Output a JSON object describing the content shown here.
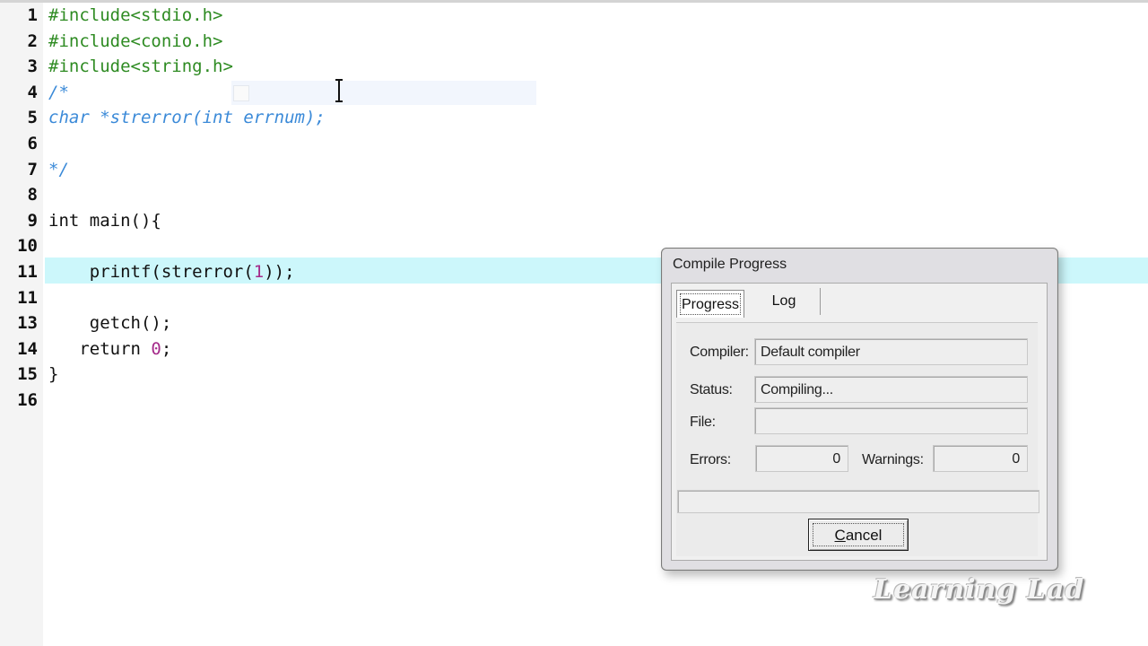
{
  "editor": {
    "active_line": 11,
    "lines": [
      {
        "n": "1",
        "segments": [
          {
            "t": "#include<stdio.h>",
            "c": "pp"
          }
        ]
      },
      {
        "n": "2",
        "segments": [
          {
            "t": "#include<conio.h>",
            "c": "pp"
          }
        ]
      },
      {
        "n": "3",
        "segments": [
          {
            "t": "#include<string.h>",
            "c": "pp"
          }
        ]
      },
      {
        "n": "4",
        "segments": [
          {
            "t": "/*",
            "c": "cm"
          }
        ]
      },
      {
        "n": "5",
        "segments": [
          {
            "t": "char *strerror(int errnum);",
            "c": "cm"
          }
        ]
      },
      {
        "n": "6",
        "segments": []
      },
      {
        "n": "7",
        "segments": [
          {
            "t": "*/",
            "c": "cm"
          }
        ]
      },
      {
        "n": "8",
        "segments": []
      },
      {
        "n": "9",
        "segments": [
          {
            "t": "int main(){",
            "c": ""
          }
        ]
      },
      {
        "n": "10",
        "segments": []
      },
      {
        "n": "11",
        "segments": [
          {
            "t": "    printf(strerror(",
            "c": ""
          },
          {
            "t": "1",
            "c": "nm"
          },
          {
            "t": "));",
            "c": ""
          }
        ]
      },
      {
        "n": "11",
        "segments": []
      },
      {
        "n": "13",
        "segments": [
          {
            "t": "    getch();",
            "c": ""
          }
        ]
      },
      {
        "n": "14",
        "segments": [
          {
            "t": "   return ",
            "c": ""
          },
          {
            "t": "0",
            "c": "nm"
          },
          {
            "t": ";",
            "c": ""
          }
        ]
      },
      {
        "n": "15",
        "segments": [
          {
            "t": "}",
            "c": ""
          }
        ]
      },
      {
        "n": "16",
        "segments": []
      }
    ]
  },
  "dialog": {
    "title": "Compile Progress",
    "tabs": [
      {
        "label": "Progress",
        "active": true
      },
      {
        "label": "Log",
        "active": false
      }
    ],
    "compiler_label": "Compiler:",
    "compiler_value": "Default compiler",
    "status_label": "Status:",
    "status_value": "Compiling...",
    "file_label": "File:",
    "file_value": "",
    "errors_label": "Errors:",
    "errors_value": "0",
    "warnings_label": "Warnings:",
    "warnings_value": "0",
    "progress_fraction": 0,
    "cancel_label_accel": "C",
    "cancel_label_rest": "ancel"
  },
  "watermark": "Learning Lad",
  "colors": {
    "preprocessor": "#2e8b22",
    "comment": "#3b8ad8",
    "number": "#a52a8a",
    "active_line_bg": "#ccf7fb"
  }
}
